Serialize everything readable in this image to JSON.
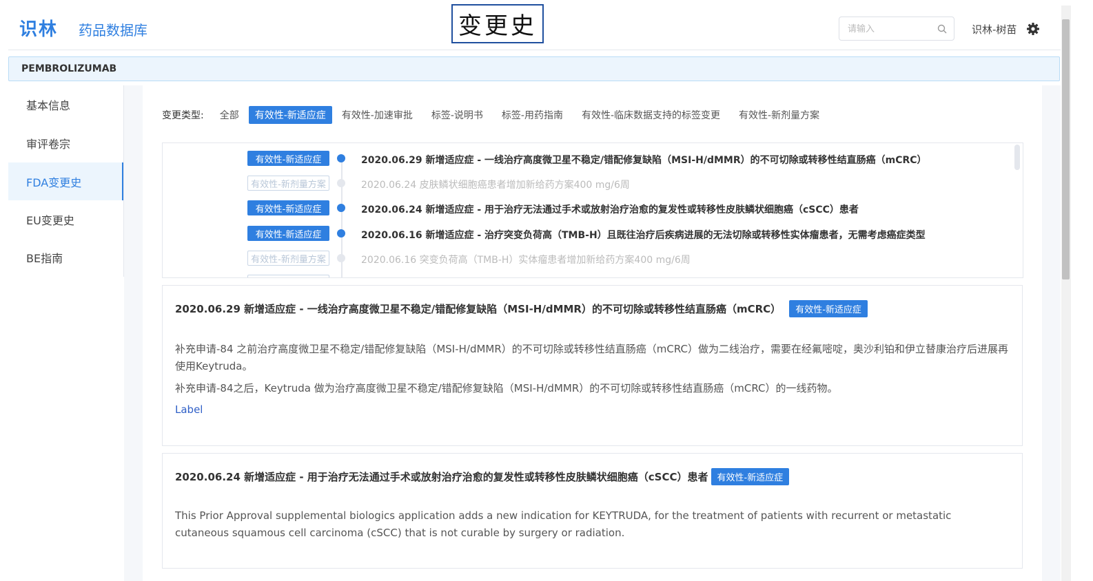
{
  "header": {
    "logo": "识林",
    "subtitle": "药品数据库",
    "overlay_title": "变更史",
    "search_placeholder": "请输入",
    "user": "识林-树苗"
  },
  "drug_name": "PEMBROLIZUMAB",
  "sidebar": {
    "items": [
      {
        "label": "基本信息",
        "active": false
      },
      {
        "label": "审评卷宗",
        "active": false
      },
      {
        "label": "FDA变更史",
        "active": true
      },
      {
        "label": "EU变更史",
        "active": false
      },
      {
        "label": "BE指南",
        "active": false
      }
    ]
  },
  "filter": {
    "label": "变更类型:",
    "options": [
      {
        "label": "全部",
        "active": false
      },
      {
        "label": "有效性-新适应症",
        "active": true
      },
      {
        "label": "有效性-加速审批",
        "active": false
      },
      {
        "label": "标签-说明书",
        "active": false
      },
      {
        "label": "标签-用药指南",
        "active": false
      },
      {
        "label": "有效性-临床数据支持的标签变更",
        "active": false
      },
      {
        "label": "有效性-新剂量方案",
        "active": false
      }
    ]
  },
  "timeline": [
    {
      "tag": "有效性-新适应症",
      "active": true,
      "text": "2020.06.29 新增适应症 - 一线治疗高度微卫星不稳定/错配修复缺陷（MSI-H/dMMR）的不可切除或转移性结直肠癌（mCRC）"
    },
    {
      "tag": "有效性-新剂量方案",
      "active": false,
      "text": "2020.06.24 皮肤鳞状细胞癌患者增加新给药方案400 mg/6周"
    },
    {
      "tag": "有效性-新适应症",
      "active": true,
      "text": "2020.06.24 新增适应症 - 用于治疗无法通过手术或放射治疗治愈的复发性或转移性皮肤鳞状细胞癌（cSCC）患者"
    },
    {
      "tag": "有效性-新适应症",
      "active": true,
      "text": "2020.06.16 新增适应症 - 治疗突变负荷高（TMB-H）且既往治疗后疾病进展的无法切除或转移性实体瘤患者，无需考虑癌症类型"
    },
    {
      "tag": "有效性-新剂量方案",
      "active": false,
      "text": "2020.06.16 突变负荷高（TMB-H）实体瘤患者增加新给药方案400 mg/6周"
    }
  ],
  "cards": [
    {
      "title": "2020.06.29 新增适应症 - 一线治疗高度微卫星不稳定/错配修复缺陷（MSI-H/dMMR）的不可切除或转移性结直肠癌（mCRC）",
      "badge": "有效性-新适应症",
      "paragraphs": [
        "补充申请-84 之前治疗高度微卫星不稳定/错配修复缺陷（MSI-H/dMMR）的不可切除或转移性结直肠癌（mCRC）做为二线治疗，需要在经氟嘧啶，奥沙利铂和伊立替康治疗后进展再使用Keytruda。",
        "补充申请-84之后，Keytruda 做为治疗高度微卫星不稳定/错配修复缺陷（MSI-H/dMMR）的不可切除或转移性结直肠癌（mCRC）的一线药物。"
      ],
      "link": "Label"
    },
    {
      "title": "2020.06.24 新增适应症 - 用于治疗无法通过手术或放射治疗治愈的复发性或转移性皮肤鳞状细胞癌（cSCC）患者",
      "badge": "有效性-新适应症",
      "paragraphs": [
        "This Prior Approval supplemental biologics application adds a new indication for KEYTRUDA, for the treatment of patients with recurrent or metastatic cutaneous squamous cell carcinoma (cSCC) that is not curable by surgery or radiation."
      ]
    }
  ]
}
